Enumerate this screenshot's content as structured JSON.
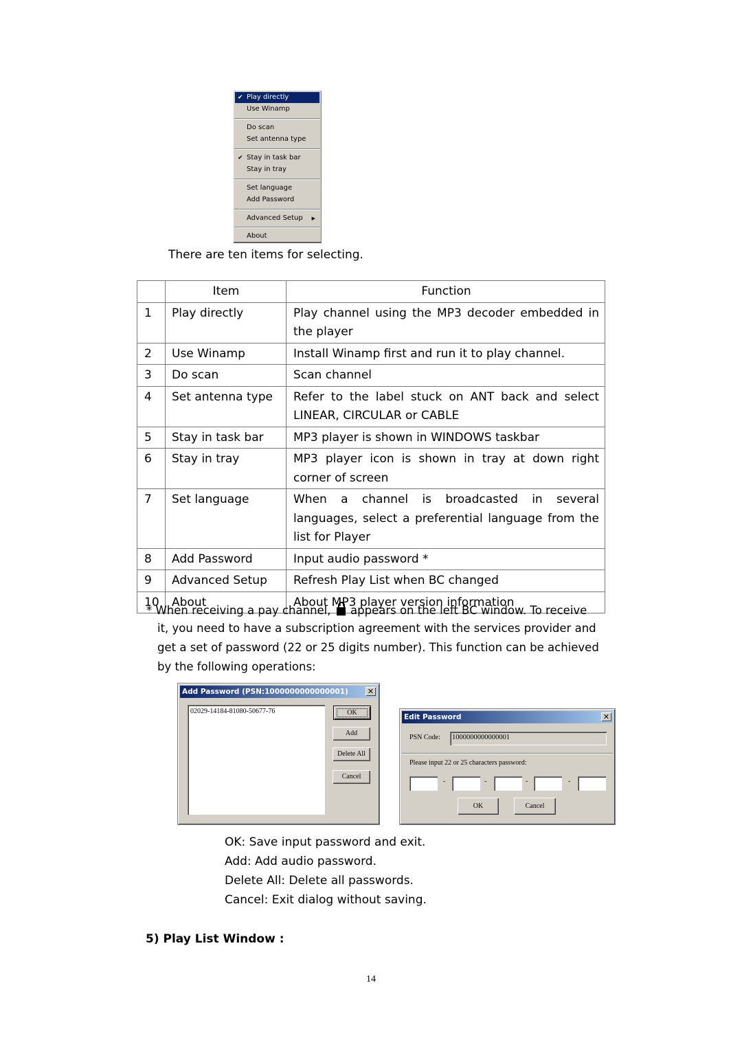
{
  "context_menu": {
    "items": [
      {
        "label": "Play directly",
        "checked": true,
        "selected": true
      },
      {
        "label": "Use Winamp",
        "checked": false
      },
      {
        "label": "Do scan",
        "checked": false
      },
      {
        "label": "Set antenna type",
        "checked": false
      },
      {
        "label": "Stay in task bar",
        "checked": true
      },
      {
        "label": "Stay in tray",
        "checked": false
      },
      {
        "label": "Set language",
        "checked": false
      },
      {
        "label": "Add Password",
        "checked": false
      },
      {
        "label": "Advanced Setup",
        "checked": false,
        "submenu": true
      },
      {
        "label": "About",
        "checked": false
      }
    ],
    "check_glyph": "✔",
    "submenu_glyph": "▶"
  },
  "intro_text": "There are ten items for selecting.",
  "table": {
    "headers": [
      "",
      "Item",
      "Function"
    ],
    "rows": [
      {
        "num": "1",
        "item": "Play directly",
        "function": "Play channel using the MP3 decoder embedded in the player"
      },
      {
        "num": "2",
        "item": "Use Winamp",
        "function": "Install Winamp first and run it to play channel."
      },
      {
        "num": "3",
        "item": "Do scan",
        "function": "Scan channel"
      },
      {
        "num": "4",
        "item": "Set antenna type",
        "function": "Refer to the label stuck on ANT back and select LINEAR, CIRCULAR or CABLE"
      },
      {
        "num": "5",
        "item": "Stay in task bar",
        "function": "MP3 player is shown in WINDOWS taskbar"
      },
      {
        "num": "6",
        "item": "Stay in tray",
        "function": "MP3 player icon is shown in tray at down right corner of screen"
      },
      {
        "num": "7",
        "item": "Set language",
        "function": "When a channel is broadcasted in several languages, select a preferential language from the list for Player"
      },
      {
        "num": "8",
        "item": "Add Password",
        "function": "Input audio password *"
      },
      {
        "num": "9",
        "item": "Advanced Setup",
        "function": "Refresh Play List when BC changed"
      },
      {
        "num": "10",
        "item": "About",
        "function": "About MP3 player version information"
      }
    ]
  },
  "footnote": {
    "part1": "* When receiving a pay channel,",
    "part2": "appears on the left BC window. To receive",
    "line2": "it, you need to have a subscription agreement with the services provider and",
    "line3": "get a set of password (22 or 25 digits number). This function can be achieved",
    "line4": "by the following operations:",
    "icon": "lock-icon"
  },
  "add_password_dialog": {
    "title": "Add Password (PSN:1000000000000001)",
    "close_glyph": "✕",
    "list_items": [
      "02029-14184-81080-50677-76"
    ],
    "buttons": {
      "ok": "OK",
      "add": "Add",
      "delete_all": "Delete All",
      "cancel": "Cancel"
    }
  },
  "edit_password_dialog": {
    "title": "Edit Password",
    "close_glyph": "✕",
    "psn_label": "PSN Code:",
    "psn_value": "1000000000000001",
    "prompt": "Please input 22 or 25 characters password:",
    "fields": [
      "",
      "",
      "",
      "",
      ""
    ],
    "separator": "-",
    "buttons": {
      "ok": "OK",
      "cancel": "Cancel"
    }
  },
  "button_descriptions": [
    "OK: Save input password and exit.",
    "Add: Add audio password.",
    "Delete All: Delete all passwords.",
    "Cancel: Exit dialog without saving."
  ],
  "section_heading": "5) Play List Window :",
  "page_number": "14"
}
